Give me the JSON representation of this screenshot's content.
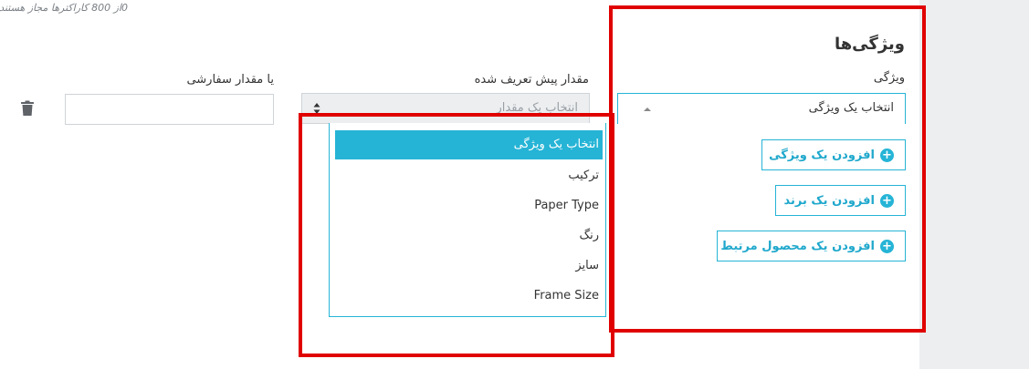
{
  "header": {
    "char_count": "0از 800 کاراکترها مجاز هستند"
  },
  "attributes": {
    "title": "ویژگی‌ها",
    "label": "ویژگی",
    "select_value": "انتخاب یک ویژگی",
    "buttons": [
      {
        "label": "افزودن یک ویژگی",
        "icon": "plus-circle-icon"
      },
      {
        "label": "افزودن یک برند",
        "icon": "plus-circle-icon"
      },
      {
        "label": "افزودن یک محصول مرتبط",
        "icon": "plus-circle-icon"
      }
    ]
  },
  "value_row": {
    "preset_label": "مقدار پیش تعریف شده",
    "preset_placeholder": "انتخاب یک مقدار",
    "custom_label": "یا مقدار سفارشی",
    "custom_value": "",
    "delete_icon": "trash-icon"
  },
  "dropdown": {
    "items": [
      {
        "label": "انتخاب یک ویژگی",
        "selected": true
      },
      {
        "label": "ترکیب"
      },
      {
        "label": "Paper Type"
      },
      {
        "label": "رنگ"
      },
      {
        "label": "سایز"
      },
      {
        "label": "Frame Size"
      }
    ]
  },
  "colors": {
    "accent": "#25b4d6",
    "highlight_box": "#e00000",
    "panel_gray": "#eceef0"
  }
}
